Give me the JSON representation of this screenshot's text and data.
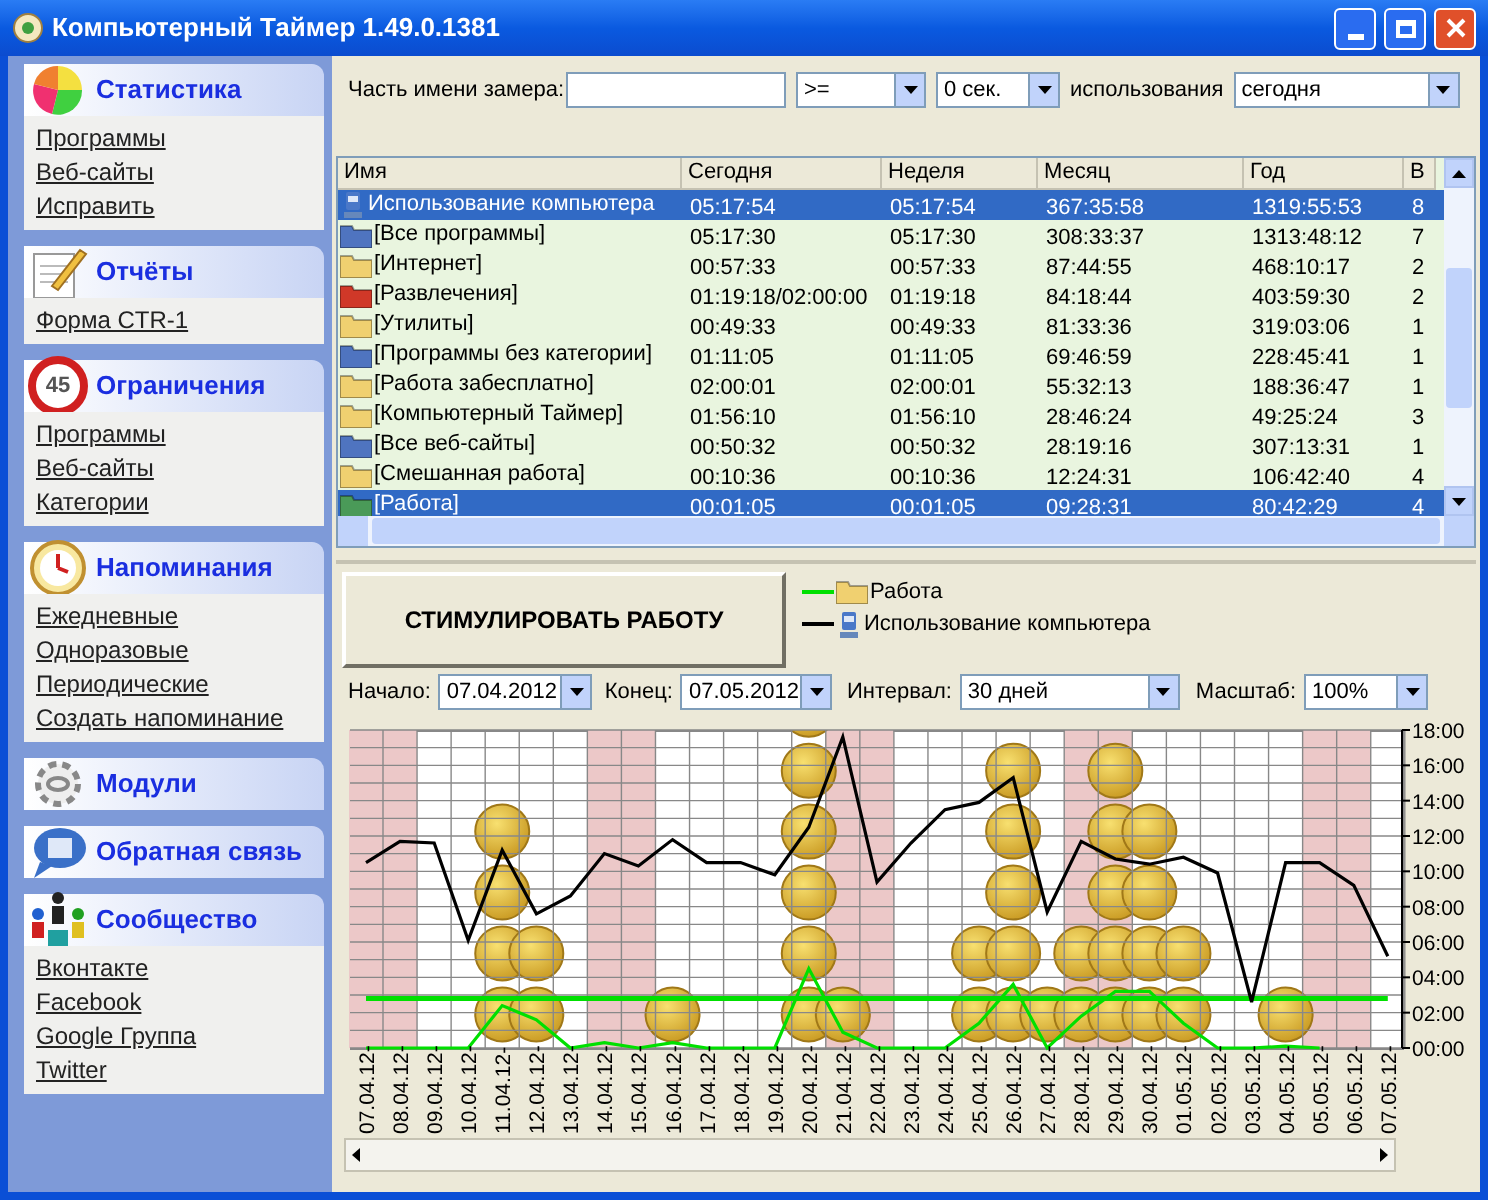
{
  "window": {
    "title": "Компьютерный Таймер 1.49.0.1381"
  },
  "sidebar": {
    "sections": [
      {
        "kind": "stats",
        "title": "Статистика",
        "links": [
          "Программы",
          "Веб-сайты",
          "Исправить"
        ]
      },
      {
        "kind": "reports",
        "title": "Отчёты",
        "links": [
          "Форма CTR-1"
        ]
      },
      {
        "kind": "limits",
        "title": "Ограничения",
        "badge": "45",
        "links": [
          "Программы",
          "Веб-сайты",
          "Категории"
        ]
      },
      {
        "kind": "reminders",
        "title": "Напоминания",
        "links": [
          "Ежедневные",
          "Одноразовые",
          "Периодические",
          "Создать напоминание"
        ]
      },
      {
        "kind": "modules",
        "title": "Модули"
      },
      {
        "kind": "feedback",
        "title": "Обратная связь"
      },
      {
        "kind": "community",
        "title": "Сообщество",
        "links": [
          "Вконтакте",
          "Facebook",
          "Google Группа",
          "Twitter"
        ]
      }
    ]
  },
  "filter": {
    "name_label": "Часть имени замера:",
    "operator": ">=",
    "amount": "0 сек.",
    "usage_label": "использования",
    "period": "сегодня"
  },
  "table": {
    "columns": [
      "Имя",
      "Сегодня",
      "Неделя",
      "Месяц",
      "Год",
      "В"
    ],
    "rows": [
      {
        "kind": "computer",
        "color": "#4a78c8",
        "selected": true,
        "cells": [
          "Использование компьютера",
          "05:17:54",
          "05:17:54",
          "367:35:58",
          "1319:55:53",
          "8"
        ]
      },
      {
        "kind": "folder",
        "color": "#4f74c0",
        "selected": false,
        "cells": [
          "[Все программы]",
          "05:17:30",
          "05:17:30",
          "308:33:37",
          "1313:48:12",
          "7"
        ]
      },
      {
        "kind": "folder",
        "color": "#f0d070",
        "selected": false,
        "cells": [
          "[Интернет]",
          "00:57:33",
          "00:57:33",
          "87:44:55",
          "468:10:17",
          "2"
        ]
      },
      {
        "kind": "folder",
        "color": "#d03828",
        "selected": false,
        "cells": [
          "[Развлечения]",
          "01:19:18/02:00:00",
          "01:19:18",
          "84:18:44",
          "403:59:30",
          "2"
        ]
      },
      {
        "kind": "folder",
        "color": "#f0d070",
        "selected": false,
        "cells": [
          "[Утилиты]",
          "00:49:33",
          "00:49:33",
          "81:33:36",
          "319:03:06",
          "1"
        ]
      },
      {
        "kind": "folder",
        "color": "#4f74c0",
        "selected": false,
        "cells": [
          "[Программы без категории]",
          "01:11:05",
          "01:11:05",
          "69:46:59",
          "228:45:41",
          "1"
        ]
      },
      {
        "kind": "folder",
        "color": "#f0d070",
        "selected": false,
        "cells": [
          "[Работа забесплатно]",
          "02:00:01",
          "02:00:01",
          "55:32:13",
          "188:36:47",
          "1"
        ]
      },
      {
        "kind": "folder",
        "color": "#f0d070",
        "selected": false,
        "cells": [
          "[Компьютерный Таймер]",
          "01:56:10",
          "01:56:10",
          "28:46:24",
          "49:25:24",
          "3"
        ]
      },
      {
        "kind": "folder",
        "color": "#4f74c0",
        "selected": false,
        "cells": [
          "[Все веб-сайты]",
          "00:50:32",
          "00:50:32",
          "28:19:16",
          "307:13:31",
          "1"
        ]
      },
      {
        "kind": "folder",
        "color": "#f0d070",
        "selected": false,
        "cells": [
          "[Смешанная работа]",
          "00:10:36",
          "00:10:36",
          "12:24:31",
          "106:42:40",
          "4"
        ]
      },
      {
        "kind": "folder",
        "color": "#4a9a58",
        "selected": true,
        "cells": [
          "[Работа]",
          "00:01:05",
          "00:01:05",
          "09:28:31",
          "80:42:29",
          "4"
        ]
      }
    ]
  },
  "stimulate_button": "СТИМУЛИРОВАТЬ РАБОТУ",
  "chart_controls": {
    "start_label": "Начало:",
    "start": "07.04.2012",
    "end_label": "Конец:",
    "end": "07.05.2012",
    "interval_label": "Интервал:",
    "interval": "30 дней",
    "scale_label": "Масштаб:",
    "scale": "100%"
  },
  "chart": {
    "legend": [
      {
        "kind": "folder"
      },
      {
        "kind": "computer"
      }
    ],
    "chart_data": {
      "type": "line",
      "categories": [
        "07.04.12-",
        "08.04.12-",
        "09.04.12-",
        "10.04.12-",
        "11.04.12-",
        "12.04.12-",
        "13.04.12-",
        "14.04.12-",
        "15.04.12-",
        "16.04.12-",
        "17.04.12-",
        "18.04.12-",
        "19.04.12-",
        "20.04.12-",
        "21.04.12-",
        "22.04.12-",
        "23.04.12-",
        "24.04.12-",
        "25.04.12-",
        "26.04.12-",
        "27.04.12-",
        "28.04.12-",
        "29.04.12-",
        "30.04.12-",
        "01.05.12-",
        "02.05.12-",
        "03.05.12-",
        "04.05.12-",
        "05.05.12-",
        "06.05.12-",
        "07.05.12-"
      ],
      "series": [
        {
          "name": "Работа",
          "color": "#00e000",
          "values": [
            0,
            0,
            0,
            0,
            2.4,
            1.6,
            0,
            0.3,
            0,
            0.3,
            0,
            0,
            0,
            4.5,
            0.9,
            0,
            0,
            0,
            1.4,
            3.6,
            0,
            1.8,
            3.2,
            3.2,
            1.4,
            0,
            0,
            0.1,
            0,
            null,
            null
          ]
        },
        {
          "name": "Использование компьютера",
          "color": "#000000",
          "values": [
            10.5,
            11.7,
            11.6,
            6.1,
            11.2,
            7.6,
            8.6,
            11.0,
            10.3,
            11.8,
            10.5,
            10.5,
            9.8,
            12.5,
            17.6,
            9.4,
            11.6,
            13.5,
            13.9,
            15.3,
            7.7,
            11.7,
            10.7,
            10.4,
            10.8,
            9.9,
            2.6,
            10.5,
            10.5,
            9.2,
            5.2
          ]
        }
      ],
      "ylim": [
        0,
        18
      ],
      "yticks": [
        {
          "value": 0,
          "label": "00:00"
        },
        {
          "value": 2,
          "label": "02:00"
        },
        {
          "value": 4,
          "label": "04:00"
        },
        {
          "value": 6,
          "label": "06:00"
        },
        {
          "value": 8,
          "label": "08:00"
        },
        {
          "value": 10,
          "label": "10:00"
        },
        {
          "value": 12,
          "label": "12:00"
        },
        {
          "value": 14,
          "label": "14:00"
        },
        {
          "value": 16,
          "label": "16:00"
        },
        {
          "value": 18,
          "label": "18:00"
        }
      ],
      "grid": true,
      "ref_lines": [
        {
          "axis": "y",
          "value": 2.8,
          "color": "#00e000"
        }
      ]
    }
  }
}
